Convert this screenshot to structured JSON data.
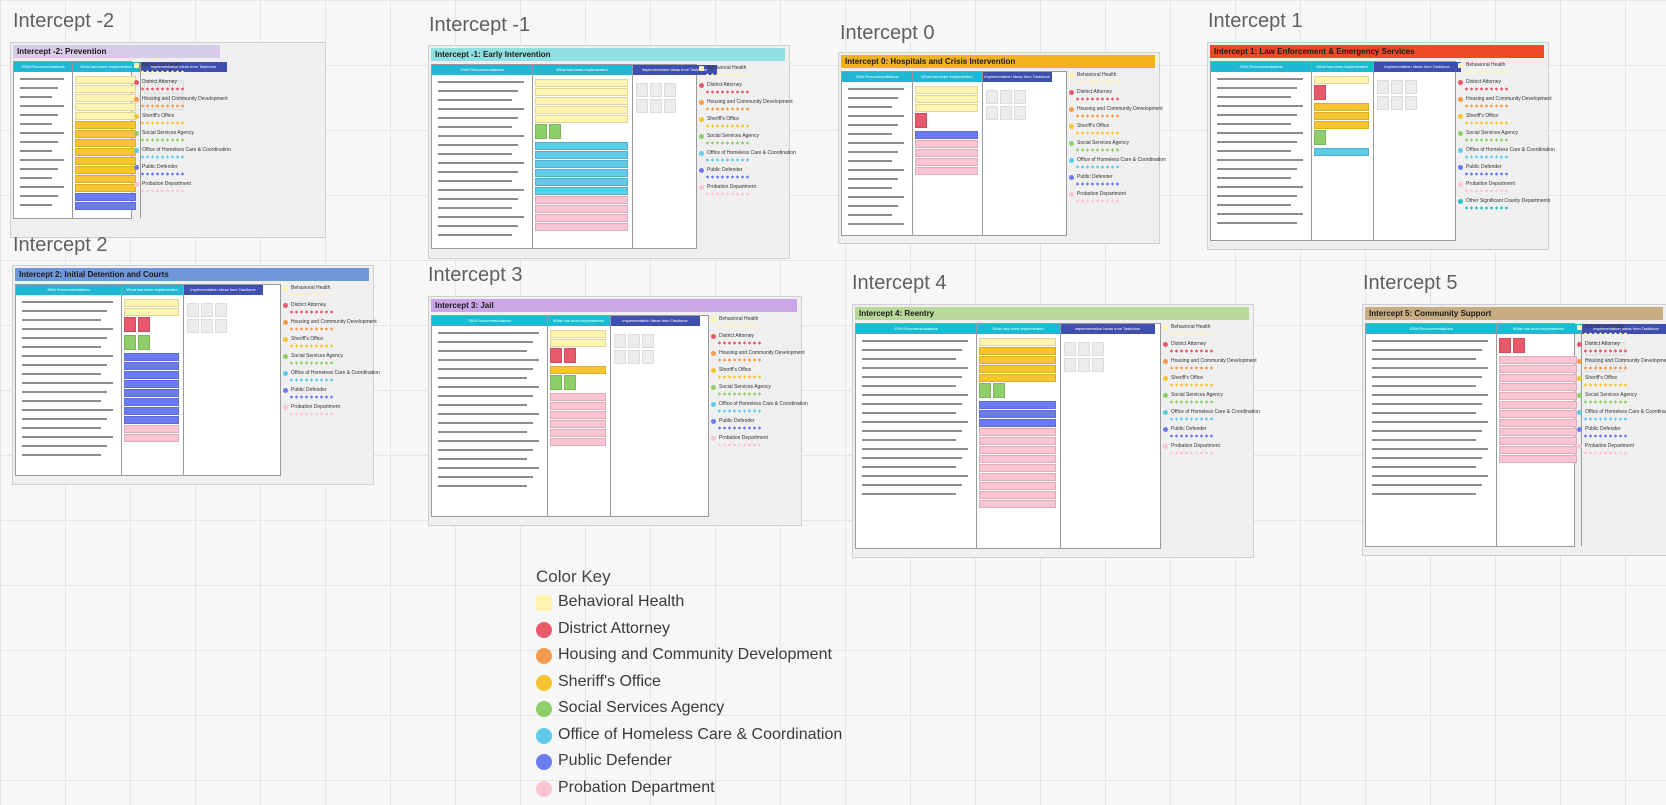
{
  "colors": {
    "behavioral_health": "#fff3b0",
    "district_attorney": "#e8596b",
    "housing": "#f59a4a",
    "sheriff": "#f7c531",
    "social_services": "#8fcf6a",
    "homeless_care": "#5fcbe8",
    "public_defender": "#6b7cf0",
    "probation": "#fbc4d3",
    "other_county": "#27c2c6",
    "col_head_cyan": "#1fb8d4",
    "col_head_blue": "#3f4fb0"
  },
  "intercepts": [
    {
      "id": "m2",
      "title": "Intercept -2",
      "banner": "Intercept -2: Prevention",
      "banner_color": "#d6cbe9"
    },
    {
      "id": "m1",
      "title": "Intercept -1",
      "banner": "Intercept -1: Early Intervention",
      "banner_color": "#8fe0e0"
    },
    {
      "id": "0",
      "title": "Intercept 0",
      "banner": "Intercept 0: Hospitals and Crisis Intervention",
      "banner_color": "#f2b21c"
    },
    {
      "id": "1",
      "title": "Intercept 1",
      "banner": "Intercept 1: Law Enforcement & Emergency Services",
      "banner_color": "#ef4a25"
    },
    {
      "id": "2",
      "title": "Intercept 2",
      "banner": "Intercept 2: Initial Detention and Courts",
      "banner_color": "#6f98da"
    },
    {
      "id": "3",
      "title": "Intercept 3",
      "banner": "Intercept 3: Jail",
      "banner_color": "#c9a6e6"
    },
    {
      "id": "4",
      "title": "Intercept 4",
      "banner": "Intercept 4: Reentry",
      "banner_color": "#b8d89a"
    },
    {
      "id": "5",
      "title": "Intercept 5",
      "banner": "Intercept 5: Community Support",
      "banner_color": "#c8ad83"
    }
  ],
  "columns": {
    "recommendations": "JSI/# Recommendations",
    "implemented": "What has been Implemented",
    "ideas": "Implementation Ideas from Taskforce"
  },
  "legend_mini": [
    "Behavioral Health",
    "District Attorney",
    "Housing and Community Development",
    "Sheriff's Office",
    "Social Services Agency",
    "Office of Homeless Care & Coordination",
    "Public Defender",
    "Probation Department",
    "Other Significant County Departments"
  ],
  "color_key": {
    "title": "Color Key",
    "items": [
      {
        "label": "Behavioral Health",
        "color": "#fff3b0",
        "shape": "square"
      },
      {
        "label": "District Attorney",
        "color": "#e8596b",
        "shape": "circle"
      },
      {
        "label": "Housing and Community Development",
        "color": "#f59a4a",
        "shape": "circle"
      },
      {
        "label": "Sheriff's Office",
        "color": "#f7c531",
        "shape": "circle"
      },
      {
        "label": "Social Services Agency",
        "color": "#8fcf6a",
        "shape": "circle"
      },
      {
        "label": "Office of Homeless Care & Coordination",
        "color": "#5fcbe8",
        "shape": "circle"
      },
      {
        "label": "Public Defender",
        "color": "#6b7cf0",
        "shape": "circle"
      },
      {
        "label": "Probation Department",
        "color": "#fbc4d3",
        "shape": "circle"
      }
    ]
  }
}
